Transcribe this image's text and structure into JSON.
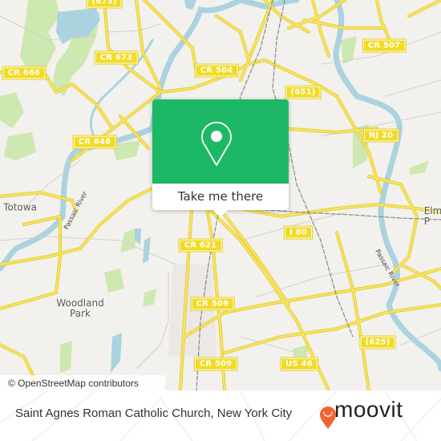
{
  "map": {
    "colors": {
      "land": "#f2f1ed",
      "water": "#aad3df",
      "park": "#cde8b0",
      "road": "#f7e26b",
      "road_outline": "#e6cc17",
      "minor_road": "#cccccc",
      "rail": "#777777",
      "popup_green": "#1db866",
      "brand_orange": "#f26530"
    },
    "road_labels": [
      {
        "id": "cr673-top",
        "text": "(673)"
      },
      {
        "id": "cr673",
        "text": "CR 673"
      },
      {
        "id": "cr666",
        "text": "CR 666"
      },
      {
        "id": "cr504",
        "text": "CR 504"
      },
      {
        "id": "cr507",
        "text": "CR 507"
      },
      {
        "id": "r651",
        "text": "(651)"
      },
      {
        "id": "cr646",
        "text": "CR 646"
      },
      {
        "id": "nj20",
        "text": "NJ 20"
      },
      {
        "id": "i80",
        "text": "I 80"
      },
      {
        "id": "cr621",
        "text": "CR 621"
      },
      {
        "id": "cr509-a",
        "text": "CR 509"
      },
      {
        "id": "cr509-b",
        "text": "CR 509"
      },
      {
        "id": "us46",
        "text": "US 46"
      },
      {
        "id": "r625",
        "text": "(625)"
      }
    ],
    "place_labels": [
      {
        "id": "totowa",
        "text": "Totowa"
      },
      {
        "id": "woodland-park",
        "text": "Woodland\nPark"
      },
      {
        "id": "elmwood-park",
        "text": "Elm\nP"
      }
    ],
    "river_labels": [
      {
        "id": "passaic-west",
        "text": "Passaic River"
      },
      {
        "id": "passaic-east",
        "text": "Passaic River"
      }
    ]
  },
  "popup": {
    "icon": "map-pin-icon",
    "button_label": "Take me there"
  },
  "attribution": "© OpenStreetMap contributors",
  "footer": {
    "title": "Saint Agnes Roman Catholic Church, New York City",
    "brand_name": "moovit",
    "brand_icon": "moovit-pin-logo-icon"
  }
}
